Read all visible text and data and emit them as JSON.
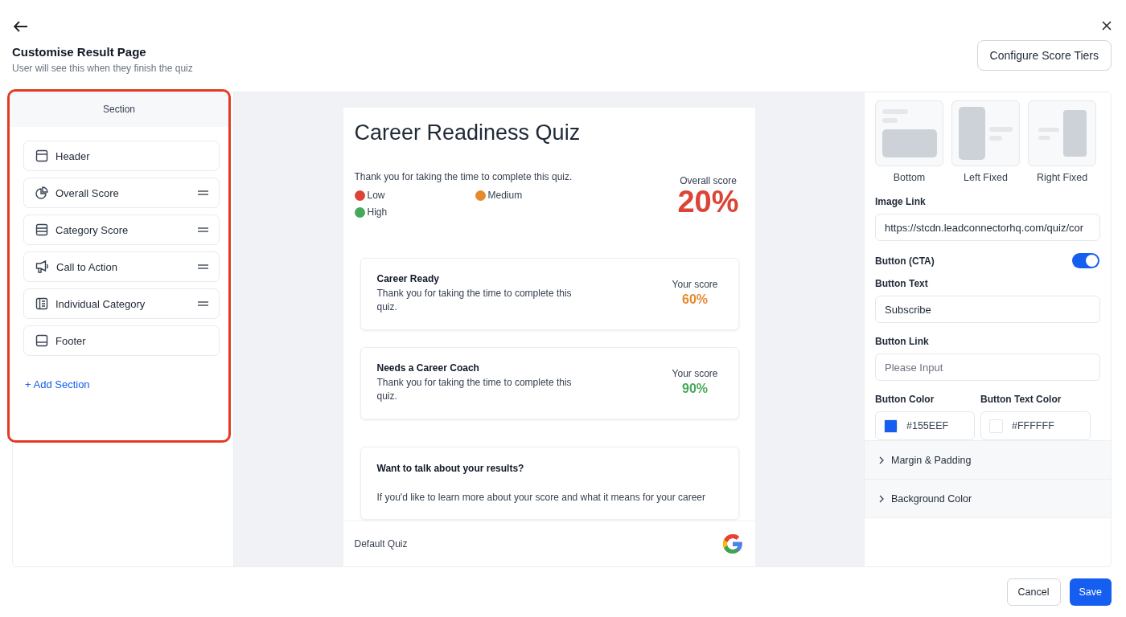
{
  "header": {
    "title": "Customise Result Page",
    "subtitle": "User will see this when they finish the quiz",
    "configure_button": "Configure Score Tiers"
  },
  "sections_panel": {
    "title": "Section",
    "items": [
      {
        "label": "Header",
        "kind": "header",
        "draggable": false
      },
      {
        "label": "Overall Score",
        "kind": "pie",
        "draggable": true
      },
      {
        "label": "Category Score",
        "kind": "rows",
        "draggable": true
      },
      {
        "label": "Call to Action",
        "kind": "megaphone",
        "draggable": true
      },
      {
        "label": "Individual Category",
        "kind": "list",
        "draggable": true
      },
      {
        "label": "Footer",
        "kind": "footer",
        "draggable": false
      }
    ],
    "add_button": "+ Add Section"
  },
  "preview": {
    "title": "Career Readiness Quiz",
    "intro": "Thank you for taking the time to complete this quiz.",
    "legend": [
      {
        "label": "Low",
        "color": "#db4436"
      },
      {
        "label": "Medium",
        "color": "#e68a2e"
      },
      {
        "label": "High",
        "color": "#45a85a"
      }
    ],
    "overall_label": "Overall score",
    "overall_value": "20%",
    "categories": [
      {
        "name": "Career Ready",
        "text": "Thank you for taking the time to complete this quiz.",
        "score_label": "Your score",
        "score": "60%",
        "color": "#e68a2e"
      },
      {
        "name": "Needs a Career Coach",
        "text": "Thank you for taking the time to complete this quiz.",
        "score_label": "Your score",
        "score": "90%",
        "color": "#45a85a"
      }
    ],
    "cta": {
      "title": "Want to talk about your results?",
      "text": "If you'd like to learn more about your score and what it means for your career"
    },
    "footer": "Default Quiz"
  },
  "settings": {
    "layouts": [
      {
        "label": "Bottom",
        "kind": "bottom"
      },
      {
        "label": "Left Fixed",
        "kind": "left"
      },
      {
        "label": "Right Fixed",
        "kind": "right"
      }
    ],
    "image_link_label": "Image Link",
    "image_link": "https://stcdn.leadconnectorhq.com/quiz/cor",
    "cta_label": "Button (CTA)",
    "cta_on": true,
    "button_text_label": "Button Text",
    "button_text": "Subscribe",
    "button_link_label": "Button Link",
    "button_link_placeholder": "Please Input",
    "button_color_label": "Button Color",
    "button_color": "#155EEF",
    "text_color_label": "Button Text Color",
    "text_color": "#FFFFFF",
    "accordions": [
      "Margin & Padding",
      "Background Color"
    ]
  },
  "buttons": {
    "cancel": "Cancel",
    "save": "Save"
  }
}
